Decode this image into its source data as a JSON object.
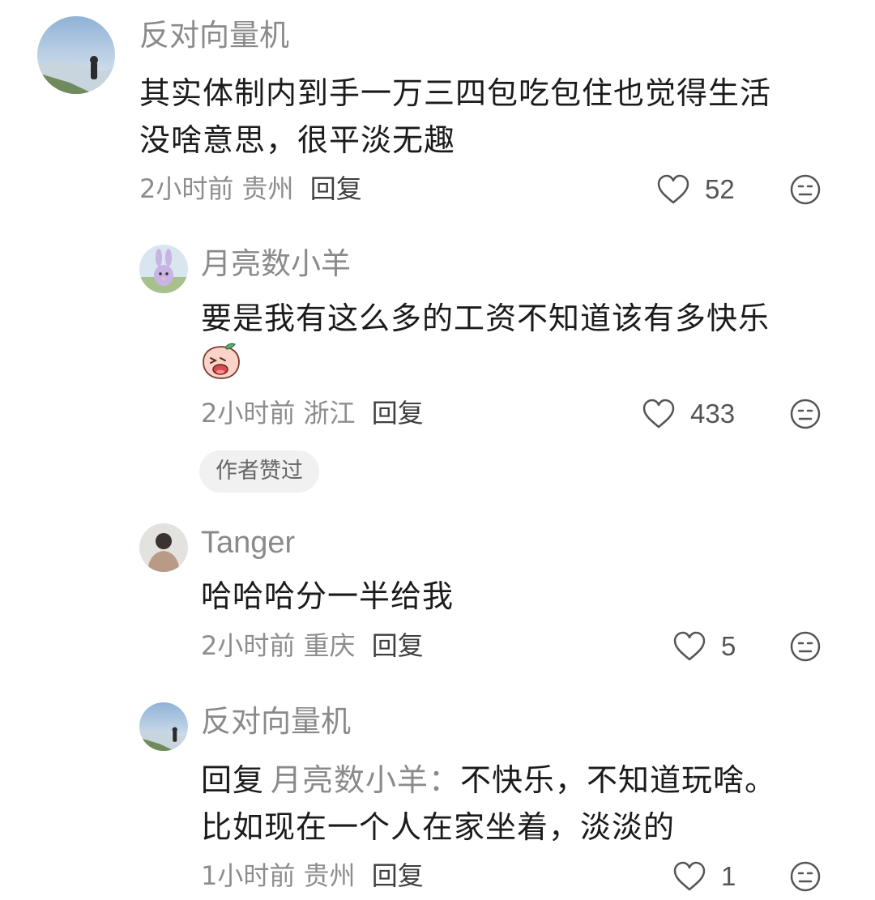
{
  "comments": [
    {
      "username": "反对向量机",
      "content_lines": [
        "其实体制内到手一万三四包吃包住也觉得生活",
        "没啥意思，很平淡无趣"
      ],
      "time": "2小时前",
      "location": "贵州",
      "reply_label": "回复",
      "likes": "52",
      "avatar_icon": "mountain-landscape-avatar"
    },
    {
      "username": "月亮数小羊",
      "content_lines": [
        "要是我有这么多的工资不知道该有多快乐"
      ],
      "sticker_icon": "crying-peach-sticker",
      "time": "2小时前",
      "location": "浙江",
      "reply_label": "回复",
      "likes": "433",
      "badge": "作者赞过",
      "avatar_icon": "bunny-character-avatar"
    },
    {
      "username": "Tanger",
      "content_lines": [
        "哈哈哈分一半给我"
      ],
      "time": "2小时前",
      "location": "重庆",
      "reply_label": "回复",
      "likes": "5",
      "avatar_icon": "person-photo-avatar"
    },
    {
      "username": "反对向量机",
      "reply_prefix": "回复",
      "mention": "月亮数小羊：",
      "content_first": "不快乐，不知道玩啥。",
      "content_second": "比如现在一个人在家坐着，淡淡的",
      "time": "1小时前",
      "location": "贵州",
      "reply_label": "回复",
      "likes": "1",
      "avatar_icon": "mountain-landscape-avatar"
    }
  ],
  "colors": {
    "secondary_text": "#8a8a8a",
    "primary_text": "#1b1b1b",
    "badge_bg": "#f1f1f1"
  }
}
